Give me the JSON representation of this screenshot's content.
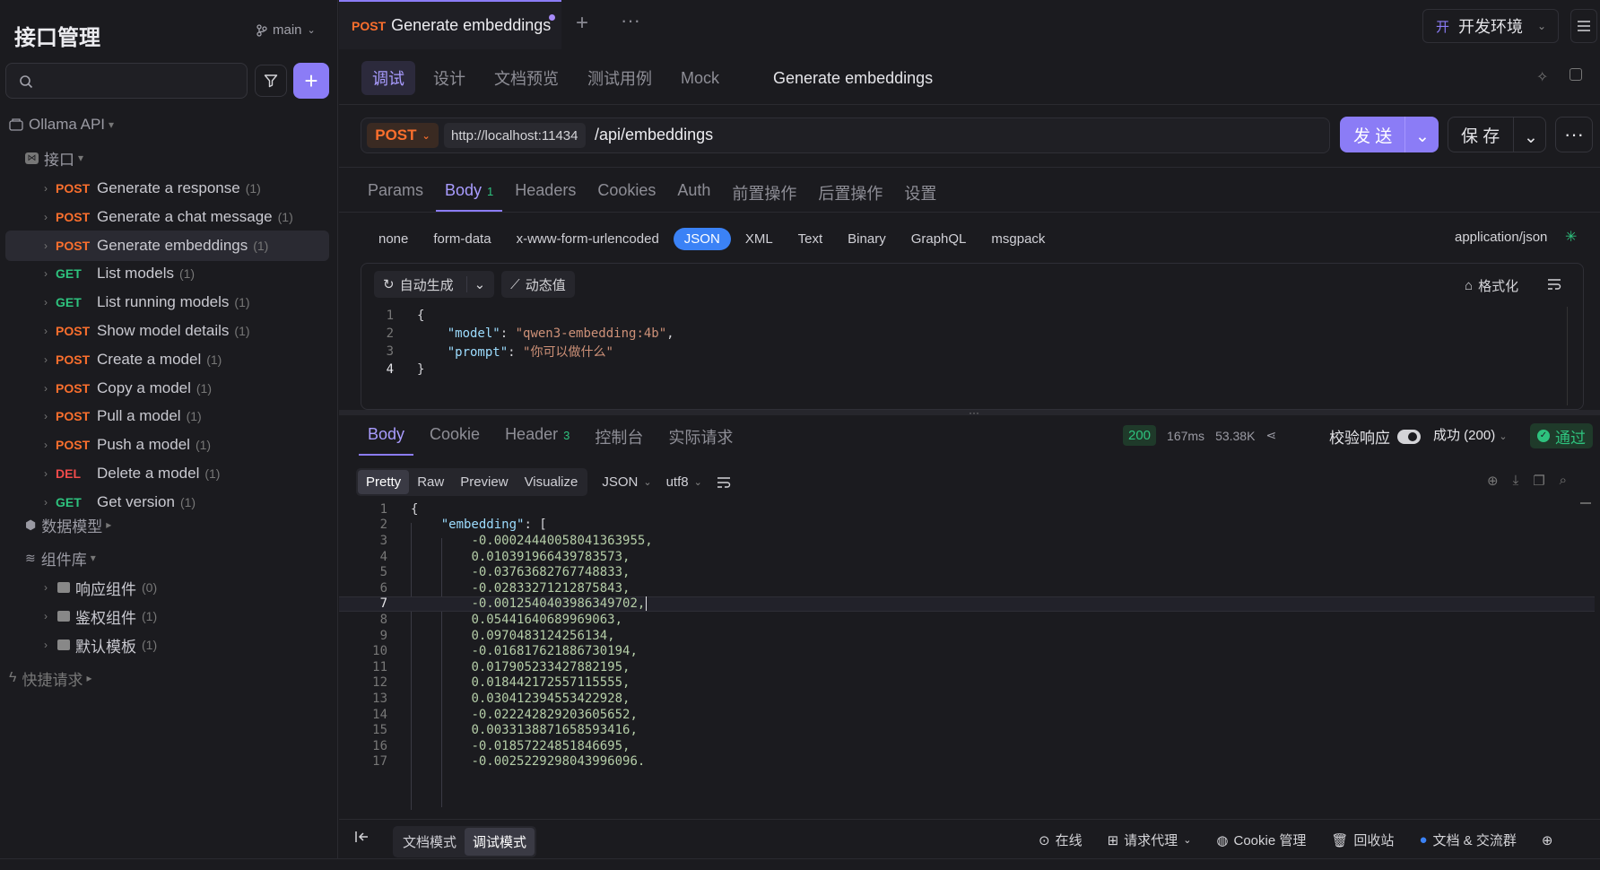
{
  "sidebar": {
    "title": "接口管理",
    "branch": "main",
    "project": "Ollama API",
    "group_label": "接口",
    "items": [
      {
        "method": "POST",
        "name": "Generate a response",
        "count": "(1)"
      },
      {
        "method": "POST",
        "name": "Generate a chat message",
        "count": "(1)"
      },
      {
        "method": "POST",
        "name": "Generate embeddings",
        "count": "(1)"
      },
      {
        "method": "GET",
        "name": "List models",
        "count": "(1)"
      },
      {
        "method": "GET",
        "name": "List running models",
        "count": "(1)"
      },
      {
        "method": "POST",
        "name": "Show model details",
        "count": "(1)"
      },
      {
        "method": "POST",
        "name": "Create a model",
        "count": "(1)"
      },
      {
        "method": "POST",
        "name": "Copy a model",
        "count": "(1)"
      },
      {
        "method": "POST",
        "name": "Pull a model",
        "count": "(1)"
      },
      {
        "method": "POST",
        "name": "Push a model",
        "count": "(1)"
      },
      {
        "method": "DEL",
        "name": "Delete a model",
        "count": "(1)"
      },
      {
        "method": "GET",
        "name": "Get version",
        "count": "(1)"
      }
    ],
    "data_models": "数据模型",
    "components": "组件库",
    "comp_items": [
      {
        "name": "响应组件",
        "count": "(0)"
      },
      {
        "name": "鉴权组件",
        "count": "(1)"
      },
      {
        "name": "默认模板",
        "count": "(1)"
      }
    ],
    "quick": "快捷请求"
  },
  "tab": {
    "method": "POST",
    "title": "Generate embeddings"
  },
  "env": {
    "icon_text": "开",
    "label": "开发环境"
  },
  "subtabs": [
    "调试",
    "设计",
    "文档预览",
    "测试用例",
    "Mock"
  ],
  "endpoint_title": "Generate embeddings",
  "request": {
    "method": "POST",
    "host": "http://localhost:11434",
    "path": "/api/embeddings",
    "send": "发 送",
    "save": "保 存"
  },
  "req_tabs": [
    "Params",
    "Body",
    "Headers",
    "Cookies",
    "Auth",
    "前置操作",
    "后置操作",
    "设置"
  ],
  "body_badge": "1",
  "body_types": [
    "none",
    "form-data",
    "x-www-form-urlencoded",
    "JSON",
    "XML",
    "Text",
    "Binary",
    "GraphQL",
    "msgpack"
  ],
  "content_type": "application/json",
  "editor": {
    "auto_gen": "自动生成",
    "dynamic": "动态值",
    "format": "格式化",
    "lines": [
      {
        "n": "1",
        "key": "",
        "val": "",
        "raw": "{"
      },
      {
        "n": "2",
        "key": "\"model\"",
        "val": "\"qwen3-embedding:4b\"",
        "raw": ""
      },
      {
        "n": "3",
        "key": "\"prompt\"",
        "val": "\"你可以做什么\"",
        "raw": ""
      },
      {
        "n": "4",
        "key": "",
        "val": "",
        "raw": "}"
      }
    ]
  },
  "resp_tabs": [
    "Body",
    "Cookie",
    "Header",
    "控制台",
    "实际请求"
  ],
  "header_badge": "3",
  "status": {
    "code": "200",
    "time": "167ms",
    "size": "53.38K"
  },
  "verify_label": "校验响应",
  "success": "成功 (200)",
  "pass": "通过",
  "view_modes": [
    "Pretty",
    "Raw",
    "Preview",
    "Visualize"
  ],
  "view_format": "JSON",
  "encoding": "utf8",
  "response_lines": [
    {
      "n": "1",
      "text": "{"
    },
    {
      "n": "2",
      "key": "\"embedding\"",
      "text": "["
    },
    {
      "n": "3",
      "num": "-0.00024440058041363955,"
    },
    {
      "n": "4",
      "num": "0.010391966439783573,"
    },
    {
      "n": "5",
      "num": "-0.03763682767748833,"
    },
    {
      "n": "6",
      "num": "-0.02833271212875843,"
    },
    {
      "n": "7",
      "num": "-0.0012540403986349702,"
    },
    {
      "n": "8",
      "num": "0.05441640689969063,"
    },
    {
      "n": "9",
      "num": "0.0970483124256134,"
    },
    {
      "n": "10",
      "num": "-0.016817621886730194,"
    },
    {
      "n": "11",
      "num": "0.017905233427882195,"
    },
    {
      "n": "12",
      "num": "0.018442172557115555,"
    },
    {
      "n": "13",
      "num": "0.030412394553422928,"
    },
    {
      "n": "14",
      "num": "-0.022242829203605652,"
    },
    {
      "n": "15",
      "num": "0.0033138871658593416,"
    },
    {
      "n": "16",
      "num": "-0.01857224851846695,"
    },
    {
      "n": "17",
      "num": "-0.0025229298043996096."
    }
  ],
  "footer": {
    "doc_mode": "文档模式",
    "debug_mode": "调试模式",
    "online": "在线",
    "proxy": "请求代理",
    "cookie": "Cookie 管理",
    "trash": "回收站",
    "docs": "文档 & 交流群"
  }
}
